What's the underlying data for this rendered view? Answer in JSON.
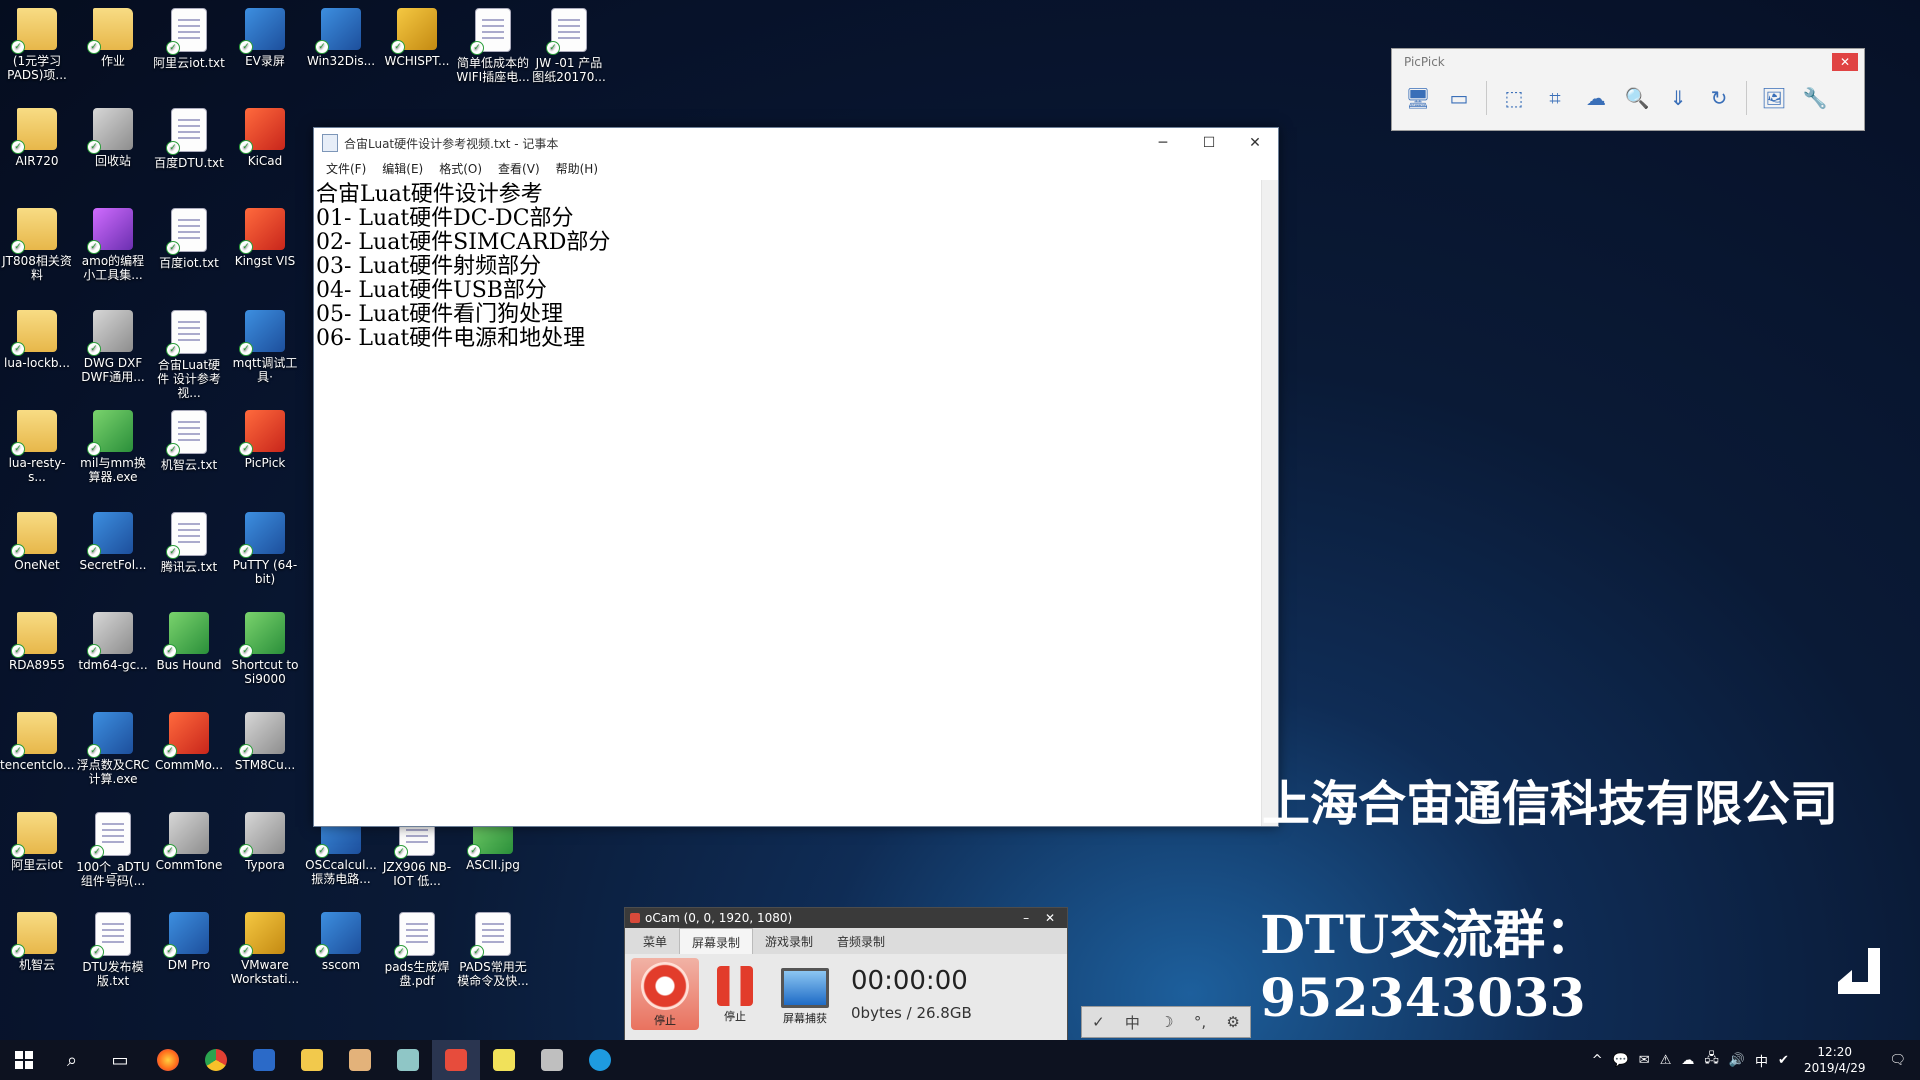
{
  "desktop_icons": [
    {
      "label": "(1元学习 PADS)项...",
      "type": "folder"
    },
    {
      "label": "作业",
      "type": "folder"
    },
    {
      "label": "阿里云iot.txt",
      "type": "doc"
    },
    {
      "label": "EV录屏",
      "type": "app"
    },
    {
      "label": "Win32Dis...",
      "type": "app"
    },
    {
      "label": "WCHISPT...",
      "type": "gold"
    },
    {
      "label": "简单低成本的 WIFI插座电...",
      "type": "doc"
    },
    {
      "label": "JW -01 产品 图纸20170...",
      "type": "doc"
    },
    {
      "label": "AIR720",
      "type": "folder"
    },
    {
      "label": "回收站",
      "type": "gray"
    },
    {
      "label": "百度DTU.txt",
      "type": "doc"
    },
    {
      "label": "KiCad",
      "type": "red"
    },
    {
      "label": "JT808相关资料",
      "type": "folder"
    },
    {
      "label": "amo的编程 小工具集...",
      "type": "purple"
    },
    {
      "label": "百度iot.txt",
      "type": "doc"
    },
    {
      "label": "Kingst VIS",
      "type": "red"
    },
    {
      "label": "lua-lockb...",
      "type": "folder"
    },
    {
      "label": "DWG DXF DWF通用...",
      "type": "gray"
    },
    {
      "label": "合宙Luat硬件 设计参考视...",
      "type": "doc"
    },
    {
      "label": "mqtt调试工 具·",
      "type": "app"
    },
    {
      "label": "lua-resty-s...",
      "type": "folder"
    },
    {
      "label": "mil与mm换 算器.exe",
      "type": "green"
    },
    {
      "label": "机智云.txt",
      "type": "doc"
    },
    {
      "label": "PicPick",
      "type": "red"
    },
    {
      "label": "OneNet",
      "type": "folder"
    },
    {
      "label": "SecretFol...",
      "type": "app"
    },
    {
      "label": "腾讯云.txt",
      "type": "doc"
    },
    {
      "label": "PuTTY (64-bit)",
      "type": "app"
    },
    {
      "label": "RDA8955",
      "type": "folder"
    },
    {
      "label": "tdm64-gc...",
      "type": "gray"
    },
    {
      "label": "Bus Hound",
      "type": "green"
    },
    {
      "label": "Shortcut to Si9000",
      "type": "green"
    },
    {
      "label": "tencentclo...",
      "type": "folder"
    },
    {
      "label": "浮点数及CRC 计算.exe",
      "type": "app"
    },
    {
      "label": "CommMo...",
      "type": "red"
    },
    {
      "label": "STM8Cu...",
      "type": "gray"
    },
    {
      "label": "阿里云iot",
      "type": "folder"
    },
    {
      "label": "100个_aDTU 组件号码(...",
      "type": "doc"
    },
    {
      "label": "CommTone",
      "type": "gray"
    },
    {
      "label": "Typora",
      "type": "gray"
    },
    {
      "label": "OSCcalcul... 振荡电路...",
      "type": "app"
    },
    {
      "label": "JZX906 NB-IOT 低...",
      "type": "doc"
    },
    {
      "label": "ASCII.jpg",
      "type": "green"
    },
    {
      "label": "机智云",
      "type": "folder"
    },
    {
      "label": "DTU发布模 版.txt",
      "type": "doc"
    },
    {
      "label": "DM Pro",
      "type": "app"
    },
    {
      "label": "VMware Workstati...",
      "type": "gold"
    },
    {
      "label": "sscom",
      "type": "app"
    },
    {
      "label": "pads生成焊 盘.pdf",
      "type": "doc"
    },
    {
      "label": "PADS常用无 模命令及快...",
      "type": "doc"
    }
  ],
  "notepad": {
    "title": "合宙Luat硬件设计参考视频.txt - 记事本",
    "menu": [
      "文件(F)",
      "编辑(E)",
      "格式(O)",
      "查看(V)",
      "帮助(H)"
    ],
    "lines": [
      "合宙Luat硬件设计参考",
      "01- Luat硬件DC-DC部分",
      "02- Luat硬件SIMCARD部分",
      "03- Luat硬件射频部分",
      "04- Luat硬件USB部分",
      "05- Luat硬件看门狗处理",
      "06- Luat硬件电源和地处理"
    ],
    "controls": {
      "minimize": "─",
      "maximize": "☐",
      "close": "✕"
    }
  },
  "picpick": {
    "title": "PicPick",
    "close": "✕",
    "tools": [
      "🖥",
      "▭",
      "⬚",
      "⌗",
      "☁",
      "🔍",
      "⇓",
      "↻",
      "🖼",
      "🔧"
    ]
  },
  "ocam": {
    "title": "oCam (0, 0, 1920, 1080)",
    "controls": {
      "minimize": "–",
      "close": "✕"
    },
    "tabs": [
      "菜单",
      "屏幕录制",
      "游戏录制",
      "音频录制"
    ],
    "buttons": {
      "record": "停止",
      "pause": "停止",
      "capture": "屏幕捕获"
    },
    "time": "00:00:00",
    "size": "0bytes / 26.8GB"
  },
  "ime": {
    "items": [
      "✓",
      "中",
      "☽",
      "°,",
      "⚙"
    ]
  },
  "overlay": {
    "company": "上海合宙通信科技有限公司",
    "group": "DTU交流群：952343033"
  },
  "taskbar": {
    "tray": [
      "^",
      "💬",
      "✉",
      "⚠",
      "☁",
      "🖧",
      "🔊",
      "中",
      "✔"
    ],
    "time": "12:20",
    "date": "2019/4/29",
    "notifications": "🗨"
  }
}
